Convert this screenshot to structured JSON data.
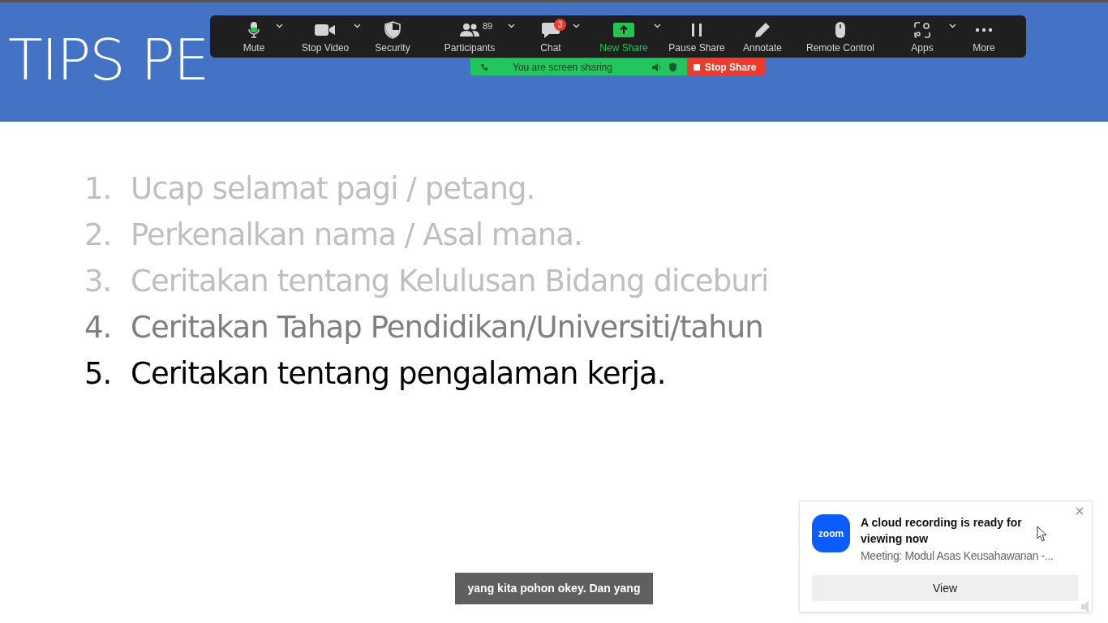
{
  "slide": {
    "title": "TIPS PE",
    "items": [
      {
        "number": "1.",
        "text": "Ucap selamat pagi / petang.",
        "color": "#bfbfbf"
      },
      {
        "number": "2.",
        "text": "Perkenalkan nama / Asal mana.",
        "color": "#bfbfbf"
      },
      {
        "number": "3.",
        "text": "Ceritakan tentang Kelulusan Bidang diceburi",
        "color": "#bfbfbf"
      },
      {
        "number": "4.",
        "text": "Ceritakan Tahap Pendidikan/Universiti/tahun",
        "color": "#7f7f7f"
      },
      {
        "number": "5.",
        "text": "Ceritakan tentang pengalaman kerja.",
        "color": "#000000"
      }
    ]
  },
  "toolbar": {
    "buttons": [
      {
        "label": "Mute",
        "has_menu": true,
        "highlighted": false
      },
      {
        "label": "Stop Video",
        "has_menu": true,
        "highlighted": false
      },
      {
        "label": "Security",
        "has_menu": false,
        "highlighted": false
      },
      {
        "label": "Participants",
        "count": "89",
        "has_menu": true,
        "highlighted": false
      },
      {
        "label": "Chat",
        "badge": "3",
        "has_menu": true,
        "highlighted": false
      },
      {
        "label": "New Share",
        "has_menu": true,
        "highlighted": true
      },
      {
        "label": "Pause Share",
        "has_menu": false,
        "highlighted": false
      },
      {
        "label": "Annotate",
        "has_menu": false,
        "highlighted": false
      },
      {
        "label": "Remote Control",
        "has_menu": false,
        "highlighted": false
      },
      {
        "label": "Apps",
        "has_menu": true,
        "highlighted": false
      },
      {
        "label": "More",
        "has_menu": false,
        "highlighted": false
      }
    ]
  },
  "sharing_bar": {
    "status": "You are screen sharing",
    "stop_button": "Stop Share"
  },
  "caption": "yang kita pohon okey. Dan yang",
  "notification": {
    "title": "A cloud recording is ready for viewing now",
    "logo": "zoom",
    "meeting": "Meeting: Modul Asas Keusahawanan -...",
    "button": "View"
  }
}
